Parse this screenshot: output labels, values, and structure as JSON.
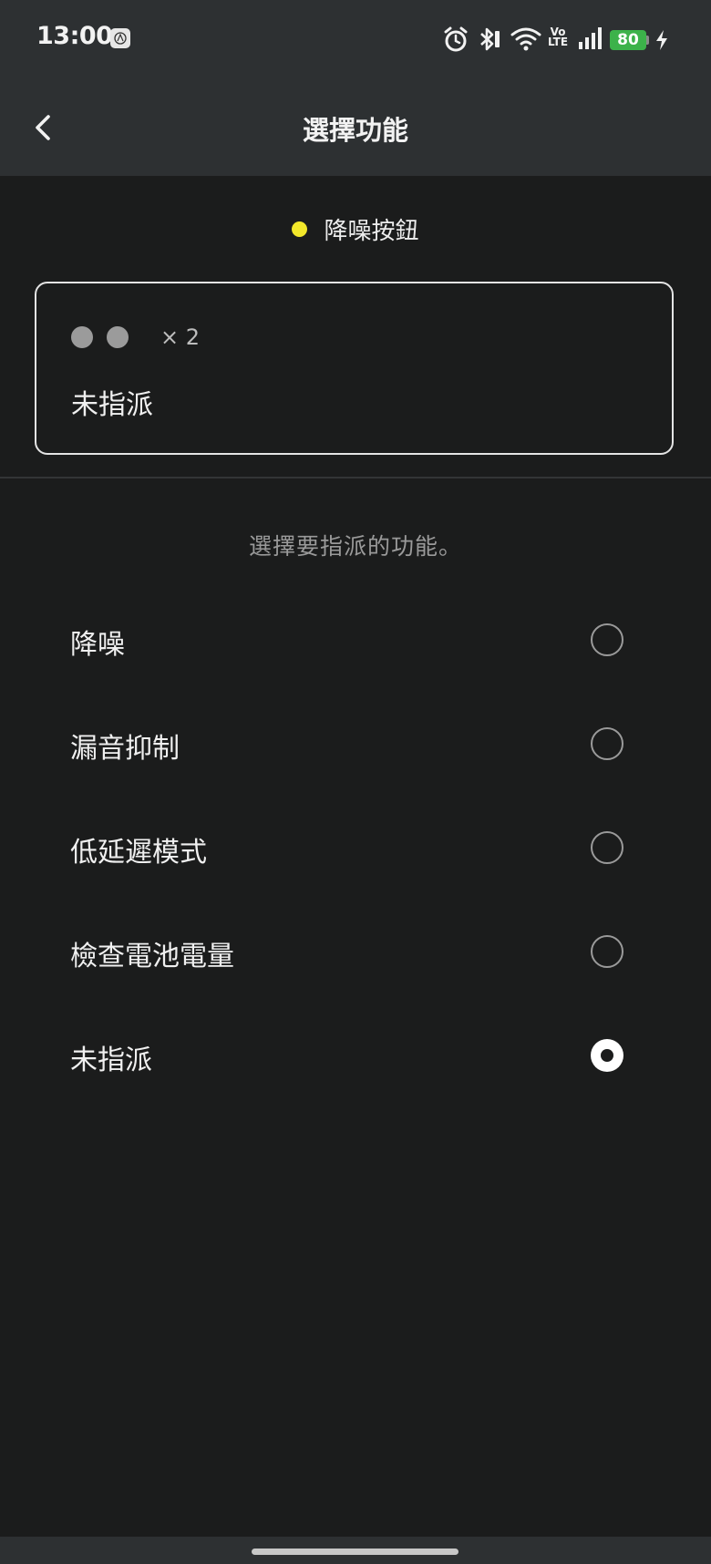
{
  "status_bar": {
    "time": "13:00",
    "network_type": "Vo\nLTE",
    "battery_level": "80",
    "icons": [
      "app-notification-icon",
      "alarm-icon",
      "bluetooth-icon",
      "wifi-icon",
      "volte-icon",
      "signal-icon",
      "battery-icon",
      "charging-icon"
    ]
  },
  "app_bar": {
    "title": "選擇功能",
    "back_icon": "chevron-left-icon"
  },
  "button_header": {
    "name": "降噪按鈕",
    "indicator_color": "#f2e72a"
  },
  "current_assignment": {
    "press_count": "× 2",
    "press_dots": 2,
    "label": "未指派"
  },
  "instruction": "選擇要指派的功能。",
  "options": [
    {
      "label": "降噪",
      "selected": false
    },
    {
      "label": "漏音抑制",
      "selected": false
    },
    {
      "label": "低延遲模式",
      "selected": false
    },
    {
      "label": "檢查電池電量",
      "selected": false
    },
    {
      "label": "未指派",
      "selected": true
    }
  ],
  "colors": {
    "background": "#1b1c1c",
    "bar": "#2d3032",
    "battery": "#3cb24a",
    "accent_dot": "#f2e72a"
  }
}
